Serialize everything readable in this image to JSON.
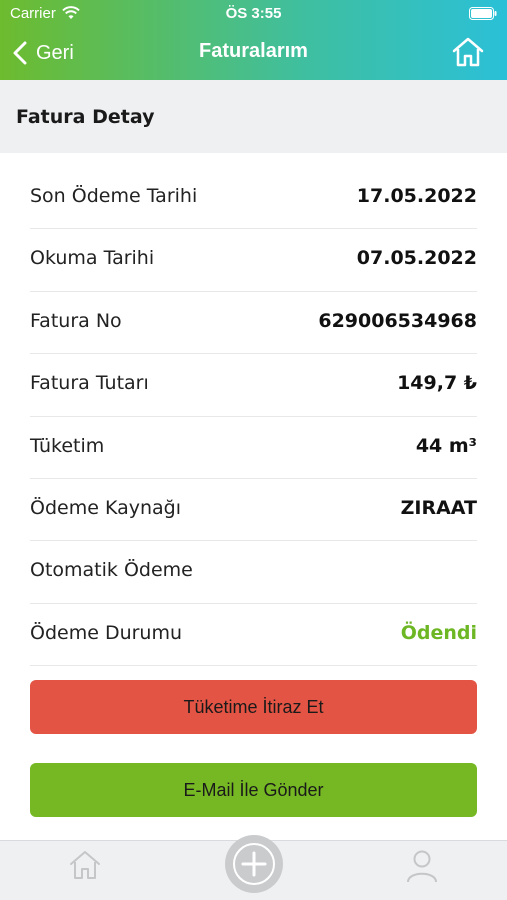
{
  "status_bar": {
    "carrier": "Carrier",
    "time": "ÖS 3:55",
    "icons": [
      "wifi-icon",
      "battery-icon"
    ]
  },
  "nav": {
    "back_label": "Geri",
    "title": "Faturalarım",
    "icons": [
      "chevron-left-icon",
      "home-icon"
    ]
  },
  "section": {
    "title": "Fatura Detay"
  },
  "details": [
    {
      "label": "Son Ödeme Tarihi",
      "value": "17.05.2022"
    },
    {
      "label": "Okuma Tarihi",
      "value": "07.05.2022"
    },
    {
      "label": "Fatura No",
      "value": "629006534968"
    },
    {
      "label": "Fatura Tutarı",
      "value": "149,7 ₺"
    },
    {
      "label": "Tüketim",
      "value": "44 m³"
    },
    {
      "label": "Ödeme Kaynağı",
      "value": "ZIRAAT"
    },
    {
      "label": "Otomatik Ödeme",
      "value": ""
    },
    {
      "label": "Ödeme Durumu",
      "value": "Ödendi"
    }
  ],
  "buttons": {
    "objection": "Tüketime İtiraz Et",
    "email": "E-Mail İle Gönder"
  },
  "tab_bar": {
    "icons": [
      "home-icon",
      "plus-circle-icon",
      "user-icon"
    ]
  },
  "colors": {
    "header_start": "#6dbb2e",
    "header_end": "#2bc0d8",
    "paid_status": "#6db725",
    "objection_button": "#e45444",
    "email_button": "#75b823"
  }
}
